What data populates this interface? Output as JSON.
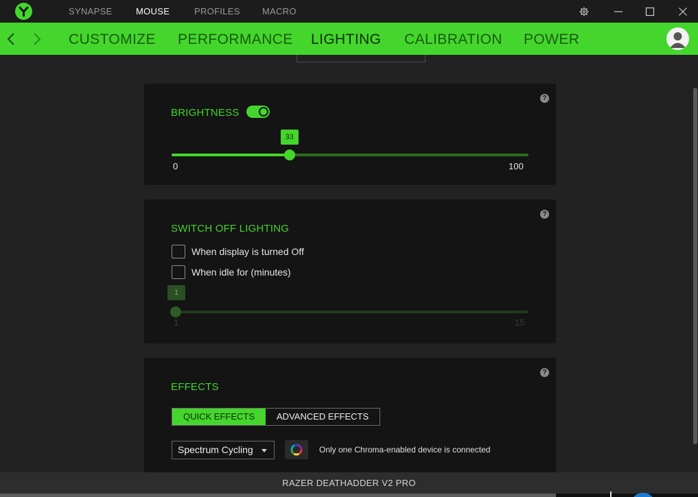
{
  "titlebar": {
    "tabs": [
      {
        "label": "SYNAPSE"
      },
      {
        "label": "MOUSE"
      },
      {
        "label": "PROFILES"
      },
      {
        "label": "MACRO"
      }
    ],
    "active_tab": "MOUSE",
    "icons": [
      "razer-logo-icon",
      "settings-icon",
      "minimize-icon",
      "maximize-icon",
      "close-icon"
    ]
  },
  "nav": {
    "tabs": [
      {
        "label": "CUSTOMIZE"
      },
      {
        "label": "PERFORMANCE"
      },
      {
        "label": "LIGHTING"
      },
      {
        "label": "CALIBRATION"
      },
      {
        "label": "POWER"
      }
    ],
    "active_tab": "LIGHTING",
    "accent_color": "#44d62c"
  },
  "brightness": {
    "title": "BRIGHTNESS",
    "enabled": true,
    "value": "33",
    "min": "0",
    "max": "100"
  },
  "switch_off": {
    "title": "SWITCH OFF LIGHTING",
    "option_display_off": "When display is turned Off",
    "option_idle": "When idle for (minutes)",
    "display_off_checked": false,
    "idle_checked": false,
    "idle_value": "1",
    "min": "1",
    "max": "15"
  },
  "effects": {
    "title": "EFFECTS",
    "quick_label": "QUICK EFFECTS",
    "advanced_label": "ADVANCED EFFECTS",
    "active_mode": "QUICK EFFECTS",
    "selected_effect": "Spectrum Cycling",
    "chroma_note": "Only one Chroma-enabled device is connected"
  },
  "help_symbol": "?",
  "footer": {
    "device_name": "RAZER DEATHADDER V2 PRO"
  }
}
